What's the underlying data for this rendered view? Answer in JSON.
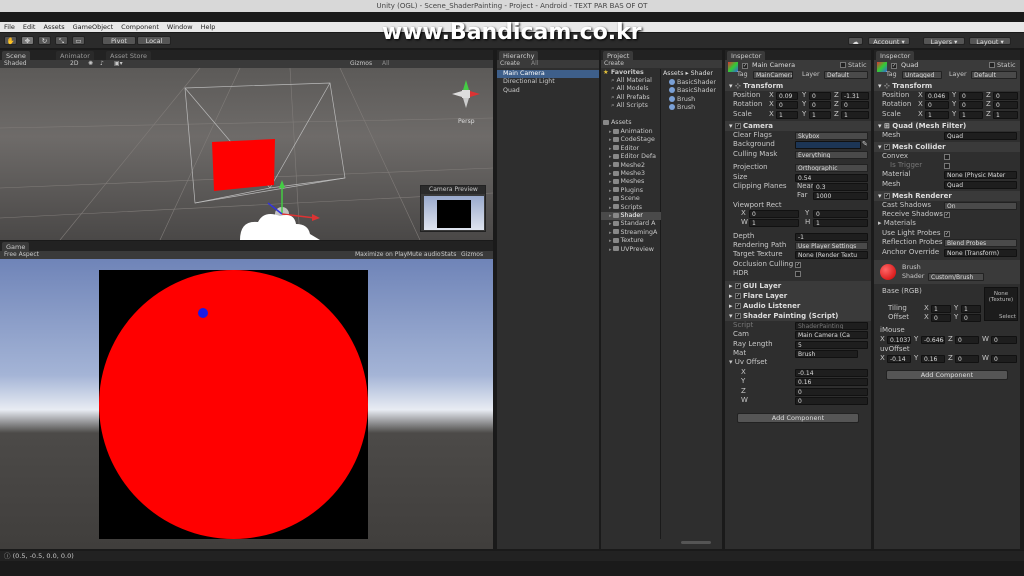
{
  "window_title": "Unity (OGL) - Scene_ShaderPainting - Project - Android - TEXT PAR BAS OF OT",
  "watermark": "www.Bandicam.co.kr",
  "menu": [
    "File",
    "Edit",
    "Assets",
    "GameObject",
    "Component",
    "Window",
    "Help"
  ],
  "toolbar": {
    "pivot": "Pivot",
    "local": "Local",
    "account": "Account",
    "layers": "Layers",
    "layout": "Layout"
  },
  "scene": {
    "tabs": [
      "Scene",
      "Animator",
      "Asset Store"
    ],
    "shaded": "Shaded",
    "mode2d": "2D",
    "gizmos": "Gizmos",
    "all": "All",
    "persp": "Persp",
    "camera_preview": "Camera Preview"
  },
  "game": {
    "tab": "Game",
    "aspect": "Free Aspect",
    "options": [
      "Maximize on Play",
      "Mute audio",
      "Stats",
      "Gizmos"
    ]
  },
  "hierarchy": {
    "tab": "Hierarchy",
    "create": "Create",
    "search": "All",
    "items": [
      "Main Camera",
      "Directional Light",
      "Quad"
    ]
  },
  "project": {
    "tab": "Project",
    "create": "Create",
    "favorites_label": "Favorites",
    "favorites": [
      "All Material",
      "All Models",
      "All Prefabs",
      "All Scripts"
    ],
    "assets_label": "Assets",
    "folders": [
      "Animation",
      "CodeStage",
      "Editor",
      "Editor Defa",
      "Meshe2",
      "Meshe3",
      "Meshes",
      "Plugins",
      "Scene",
      "Scripts",
      "Shader",
      "Standard A",
      "StreamingA",
      "Texture",
      "UVPreview"
    ],
    "breadcrumb": "Assets ▸ Shader",
    "files": [
      "BasicShader",
      "BasicShader",
      "Brush",
      "Brush"
    ]
  },
  "inspector1": {
    "tab": "Inspector",
    "name": "Main Camera",
    "static": "Static",
    "tag_label": "Tag",
    "tag": "MainCamera",
    "layer_label": "Layer",
    "layer": "Default",
    "transform": "Transform",
    "position_label": "Position",
    "position": {
      "x": "0.09",
      "y": "0",
      "z": "-1.31"
    },
    "rotation_label": "Rotation",
    "rotation": {
      "x": "0",
      "y": "0",
      "z": "0"
    },
    "scale_label": "Scale",
    "scale": {
      "x": "1",
      "y": "1",
      "z": "1"
    },
    "camera": "Camera",
    "clear_flags_label": "Clear Flags",
    "clear_flags": "Skybox",
    "background_label": "Background",
    "culling_label": "Culling Mask",
    "culling": "Everything",
    "projection_label": "Projection",
    "projection": "Orthographic",
    "size_label": "Size",
    "size": "0.54",
    "clipping_label": "Clipping Planes",
    "near_label": "Near",
    "near": "0.3",
    "far_label": "Far",
    "far": "1000",
    "viewport_label": "Viewport Rect",
    "vx": "0",
    "vy": "0",
    "vw": "1",
    "vh": "1",
    "depth_label": "Depth",
    "depth": "-1",
    "render_path_label": "Rendering Path",
    "render_path": "Use Player Settings",
    "target_tex_label": "Target Texture",
    "target_tex": "None (Render Textu",
    "occlusion_label": "Occlusion Culling",
    "hdr_label": "HDR",
    "gui_layer": "GUI Layer",
    "flare_layer": "Flare Layer",
    "audio_listener": "Audio Listener",
    "script_comp": "Shader Painting (Script)",
    "script_label": "Script",
    "script": "ShaderPainting",
    "cam_label": "Cam",
    "cam": "Main Camera (Ca",
    "ray_label": "Ray Length",
    "ray": "5",
    "mat_label": "Mat",
    "mat": "Brush",
    "uv_label": "Uv Offset",
    "uvx": "-0.14",
    "uvy": "0.16",
    "uvz": "0",
    "uvw": "0",
    "add_component": "Add Component"
  },
  "inspector2": {
    "tab": "Inspector",
    "name": "Quad",
    "static": "Static",
    "tag_label": "Tag",
    "tag": "Untagged",
    "layer_label": "Layer",
    "layer": "Default",
    "transform": "Transform",
    "position": {
      "x": "0.046",
      "y": "0",
      "z": "0"
    },
    "rotation": {
      "x": "0",
      "y": "0",
      "z": "0"
    },
    "scale": {
      "x": "1",
      "y": "1",
      "z": "1"
    },
    "mesh_filter": "Quad (Mesh Filter)",
    "mesh_label": "Mesh",
    "mesh": "Quad",
    "mesh_collider": "Mesh Collider",
    "convex_label": "Convex",
    "trigger_label": "Is Trigger",
    "material_label": "Material",
    "material": "None (Physic Mater",
    "mesh2": "Quad",
    "mesh_renderer": "Mesh Renderer",
    "cast_label": "Cast Shadows",
    "cast": "On",
    "receive_label": "Receive Shadows",
    "materials_label": "Materials",
    "light_probes_label": "Use Light Probes",
    "reflection_label": "Reflection Probes",
    "reflection": "Blend Probes",
    "anchor_label": "Anchor Override",
    "anchor": "None (Transform)",
    "brush": "Brush",
    "shader_label": "Shader",
    "shader": "Custom/Brush",
    "base_label": "Base (RGB)",
    "none_tex": "None (Texture)",
    "tiling_label": "Tiling",
    "offset_label": "Offset",
    "tx": "1",
    "ty": "1",
    "ox": "0",
    "oy": "0",
    "select": "Select",
    "imouse_label": "iMouse",
    "mx": "0.10376",
    "my": "-0.6464",
    "mz": "0",
    "mw": "0",
    "uvoffset_label": "uvOffset",
    "ux": "-0.14",
    "uy": "0.16",
    "uz": "0",
    "uw": "0",
    "add_component": "Add Component"
  },
  "status_bar": "(0.5, -0.5, 0.0, 0.0)",
  "colors": {
    "red": "#ff0000",
    "blue": "#1a1ae6",
    "sky": "#9aaacd"
  }
}
